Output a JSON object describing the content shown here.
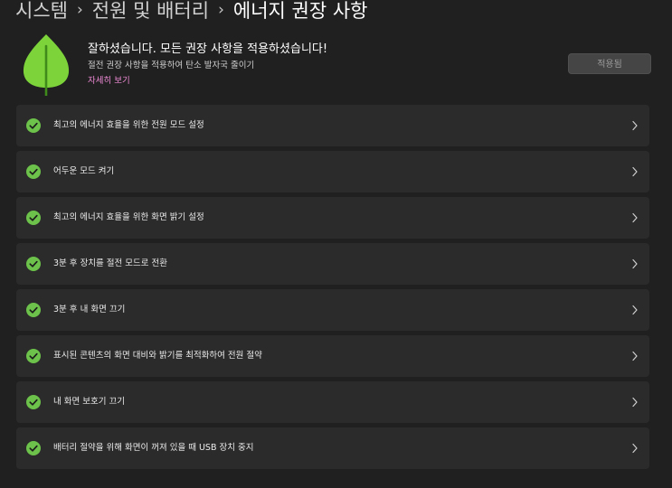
{
  "breadcrumb": {
    "items": [
      "시스템",
      "전원 및 배터리"
    ],
    "current": "에너지 권장 사항",
    "separator": "›"
  },
  "hero": {
    "icon": "leaf-icon",
    "title": "잘하셨습니다. 모든 권장 사항을 적용하셨습니다!",
    "subtitle": "절전 권장 사항을 적용하여 탄소 발자국 줄이기",
    "link": "자세히 보기",
    "button_label": "적용됨"
  },
  "recommendations": [
    {
      "label": "최고의 에너지 효율을 위한 전원 모드 설정",
      "status_icon": "check-circle-icon"
    },
    {
      "label": "어두운 모드 켜기",
      "status_icon": "check-circle-icon"
    },
    {
      "label": "최고의 에너지 효율을 위한 화면 밝기 설정",
      "status_icon": "check-circle-icon"
    },
    {
      "label": "3분 후 장치를 절전 모드로 전환",
      "status_icon": "check-circle-icon"
    },
    {
      "label": "3분 후 내 화면 끄기",
      "status_icon": "check-circle-icon"
    },
    {
      "label": "표시된 콘텐츠의 화면 대비와 밝기를 최적화하여 전원 절약",
      "status_icon": "check-circle-icon"
    },
    {
      "label": "내 화면 보호기 끄기",
      "status_icon": "check-circle-icon"
    },
    {
      "label": "배터리 절약을 위해 화면이 꺼져 있을 때 USB 장치 중지",
      "status_icon": "check-circle-icon"
    }
  ],
  "colors": {
    "background": "#202020",
    "card": "#2b2b2b",
    "leaf": "#7cd43a",
    "check": "#6cc24a",
    "link": "#ee8ad5",
    "applied_button": "#454545"
  }
}
